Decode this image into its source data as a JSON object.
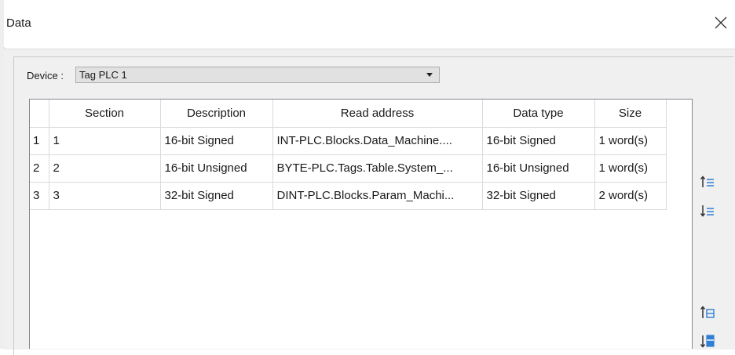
{
  "window": {
    "title": "Data"
  },
  "device": {
    "label": "Device :",
    "value": "Tag PLC 1"
  },
  "grid": {
    "columns": [
      "",
      "Section",
      "Description",
      "Read address",
      "Data type",
      "Size"
    ],
    "rows": [
      {
        "index": "1",
        "section": "1",
        "description": "16-bit Signed",
        "read_address": "INT-PLC.Blocks.Data_Machine....",
        "data_type": "16-bit Signed",
        "size": "1 word(s)"
      },
      {
        "index": "2",
        "section": "2",
        "description": "16-bit Unsigned",
        "read_address": "BYTE-PLC.Tags.Table.System_...",
        "data_type": "16-bit Unsigned",
        "size": "1 word(s)"
      },
      {
        "index": "3",
        "section": "3",
        "description": "32-bit Signed",
        "read_address": "DINT-PLC.Blocks.Param_Machi...",
        "data_type": "32-bit Signed",
        "size": "2 word(s)"
      }
    ]
  },
  "toolbar": {
    "icons": [
      "sort-ascending-icon",
      "sort-descending-icon",
      "move-to-top-icon",
      "move-to-bottom-icon"
    ],
    "accent": "#2f7fd6"
  }
}
